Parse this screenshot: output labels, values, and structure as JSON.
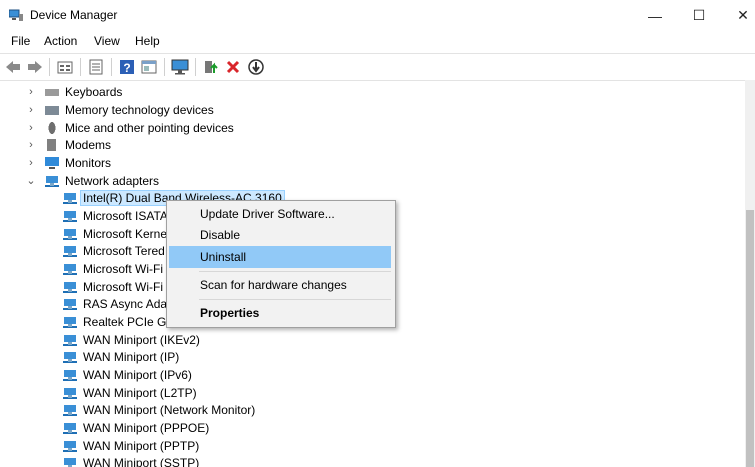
{
  "window": {
    "title": "Device Manager",
    "minimize": "—",
    "maximize": "☐",
    "close": "✕"
  },
  "menu": [
    "File",
    "Action",
    "View",
    "Help"
  ],
  "toolbar": [
    "back-arrow",
    "forward-arrow",
    "properties",
    "view-list",
    "help",
    "show-hidden",
    "scan-monitor",
    "update-driver",
    "uninstall",
    "disable"
  ],
  "tree": [
    {
      "label": "Keyboards",
      "icon": "keyboard-icon",
      "expander": "›"
    },
    {
      "label": "Memory technology devices",
      "icon": "memory-icon",
      "expander": "›"
    },
    {
      "label": "Mice and other pointing devices",
      "icon": "mouse-icon",
      "expander": "›"
    },
    {
      "label": "Modems",
      "icon": "modem-icon",
      "expander": "›"
    },
    {
      "label": "Monitors",
      "icon": "monitor-icon",
      "expander": "›"
    },
    {
      "label": "Network adapters",
      "icon": "network-adapter-icon",
      "expander": "⌄"
    },
    {
      "label": "Intel(R) Dual Band Wireless-AC 3160",
      "icon": "network-adapter-icon"
    },
    {
      "label": "Microsoft ISATA",
      "icon": "network-adapter-icon"
    },
    {
      "label": "Microsoft Kerne",
      "icon": "network-adapter-icon"
    },
    {
      "label": "Microsoft Tered",
      "icon": "network-adapter-icon"
    },
    {
      "label": "Microsoft Wi-Fi",
      "icon": "network-adapter-icon"
    },
    {
      "label": "Microsoft Wi-Fi",
      "icon": "network-adapter-icon"
    },
    {
      "label": "RAS Async Adap",
      "icon": "network-adapter-icon"
    },
    {
      "label": "Realtek PCIe GB",
      "icon": "network-adapter-icon"
    },
    {
      "label": "WAN Miniport (IKEv2)",
      "icon": "network-adapter-icon"
    },
    {
      "label": "WAN Miniport (IP)",
      "icon": "network-adapter-icon"
    },
    {
      "label": "WAN Miniport (IPv6)",
      "icon": "network-adapter-icon"
    },
    {
      "label": "WAN Miniport (L2TP)",
      "icon": "network-adapter-icon"
    },
    {
      "label": "WAN Miniport (Network Monitor)",
      "icon": "network-adapter-icon"
    },
    {
      "label": "WAN Miniport (PPPOE)",
      "icon": "network-adapter-icon"
    },
    {
      "label": "WAN Miniport (PPTP)",
      "icon": "network-adapter-icon"
    },
    {
      "label": "WAN Miniport (SSTP)",
      "icon": "network-adapter-icon"
    }
  ],
  "context_menu": {
    "items": [
      "Update Driver Software...",
      "Disable",
      "Uninstall",
      "Scan for hardware changes",
      "Properties"
    ],
    "highlighted": "Uninstall"
  },
  "colors": {
    "selection": "#cce8ff",
    "menu_highlight": "#91c9f7",
    "uninstall_red": "#d9262b"
  }
}
